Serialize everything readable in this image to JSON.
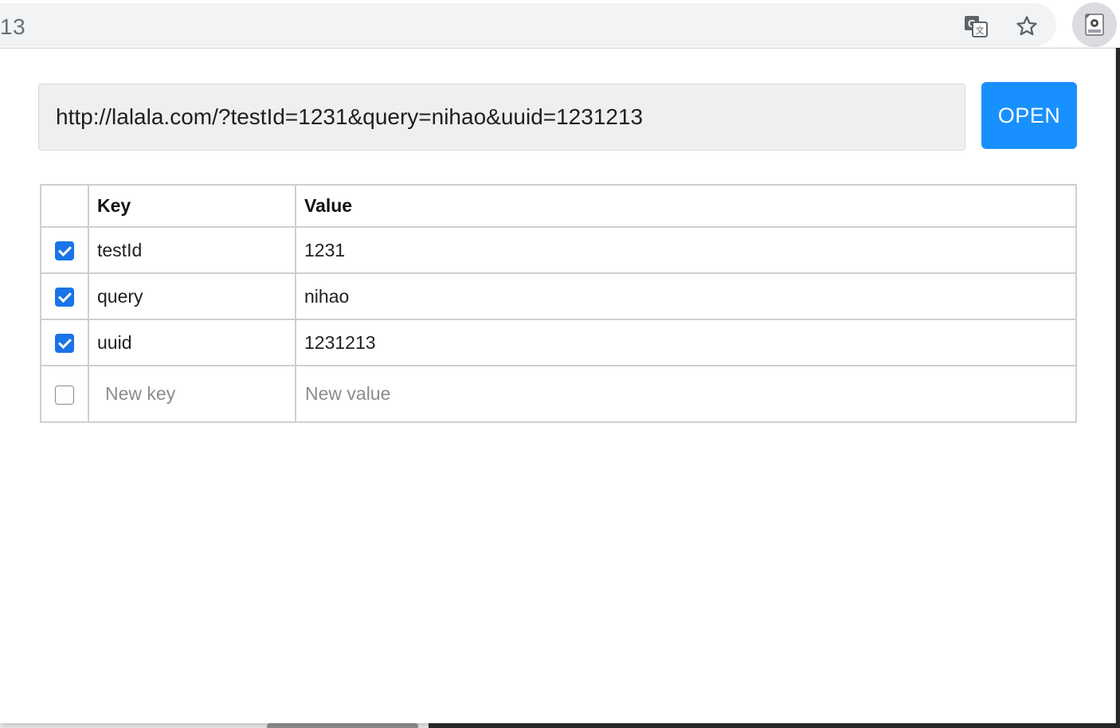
{
  "browser": {
    "url_fragment": "13",
    "translate_icon": "google-translate-icon",
    "star_icon": "bookmark-star-icon",
    "extension_icon": "url-params-extension-icon"
  },
  "popup": {
    "url_value": "http://lalala.com/?testId=1231&query=nihao&uuid=1231213",
    "open_label": "OPEN",
    "colors": {
      "accent": "#1890ff",
      "checkbox": "#1a73e8"
    }
  },
  "table": {
    "headers": {
      "key": "Key",
      "value": "Value"
    },
    "rows": [
      {
        "checked": true,
        "key": "testId",
        "value": "1231"
      },
      {
        "checked": true,
        "key": "query",
        "value": "nihao"
      },
      {
        "checked": true,
        "key": "uuid",
        "value": "1231213"
      }
    ],
    "new_row": {
      "checked": false,
      "key_placeholder": "New key",
      "value_placeholder": "New value"
    }
  }
}
